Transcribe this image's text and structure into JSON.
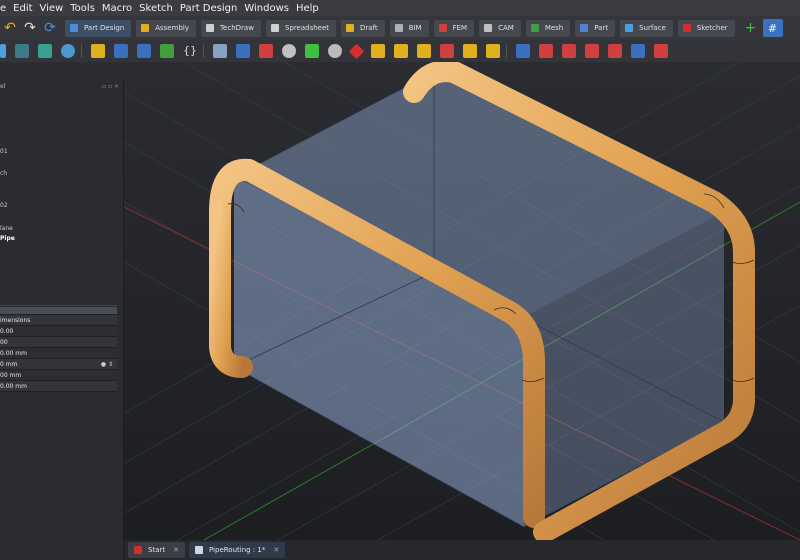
{
  "menubar": {
    "items": [
      "e",
      "Edit",
      "View",
      "Tools",
      "Macro",
      "Sketch",
      "Part Design",
      "Windows",
      "Help"
    ]
  },
  "workbenches": [
    {
      "label": "Part Design",
      "color": "#4a90d9",
      "active": true
    },
    {
      "label": "Assembly",
      "color": "#e0b020"
    },
    {
      "label": "TechDraw",
      "color": "#cfcfcf"
    },
    {
      "label": "Spreadsheet",
      "color": "#cfcfcf"
    },
    {
      "label": "Draft",
      "color": "#e0b020"
    },
    {
      "label": "BIM",
      "color": "#aab0b8"
    },
    {
      "label": "FEM",
      "color": "#d04040"
    },
    {
      "label": "CAM",
      "color": "#c0c0c0"
    },
    {
      "label": "Mesh",
      "color": "#40a040"
    },
    {
      "label": "Part",
      "color": "#5080d0"
    },
    {
      "label": "Surface",
      "color": "#4aa0e0"
    },
    {
      "label": "Sketcher",
      "color": "#d03030"
    }
  ],
  "tree": {
    "items": [
      {
        "label": "el"
      },
      {
        "label": "01"
      },
      {
        "label": "ch"
      },
      {
        "label": "02"
      },
      {
        "label": "lane"
      },
      {
        "label": "Pipe"
      }
    ]
  },
  "properties": {
    "header": "imensions",
    "rows": [
      "0.00",
      "00",
      "0.00 mm",
      "0 mm",
      "00 mm",
      "0.00 mm"
    ]
  },
  "doc_tabs": [
    {
      "label": "Start",
      "close": "✕",
      "active": false
    },
    {
      "label": "PipeRouting : 1*",
      "close": "✕",
      "active": true
    }
  ],
  "colors": {
    "pipe": "#e0a050",
    "box": "#8fa7cf"
  }
}
